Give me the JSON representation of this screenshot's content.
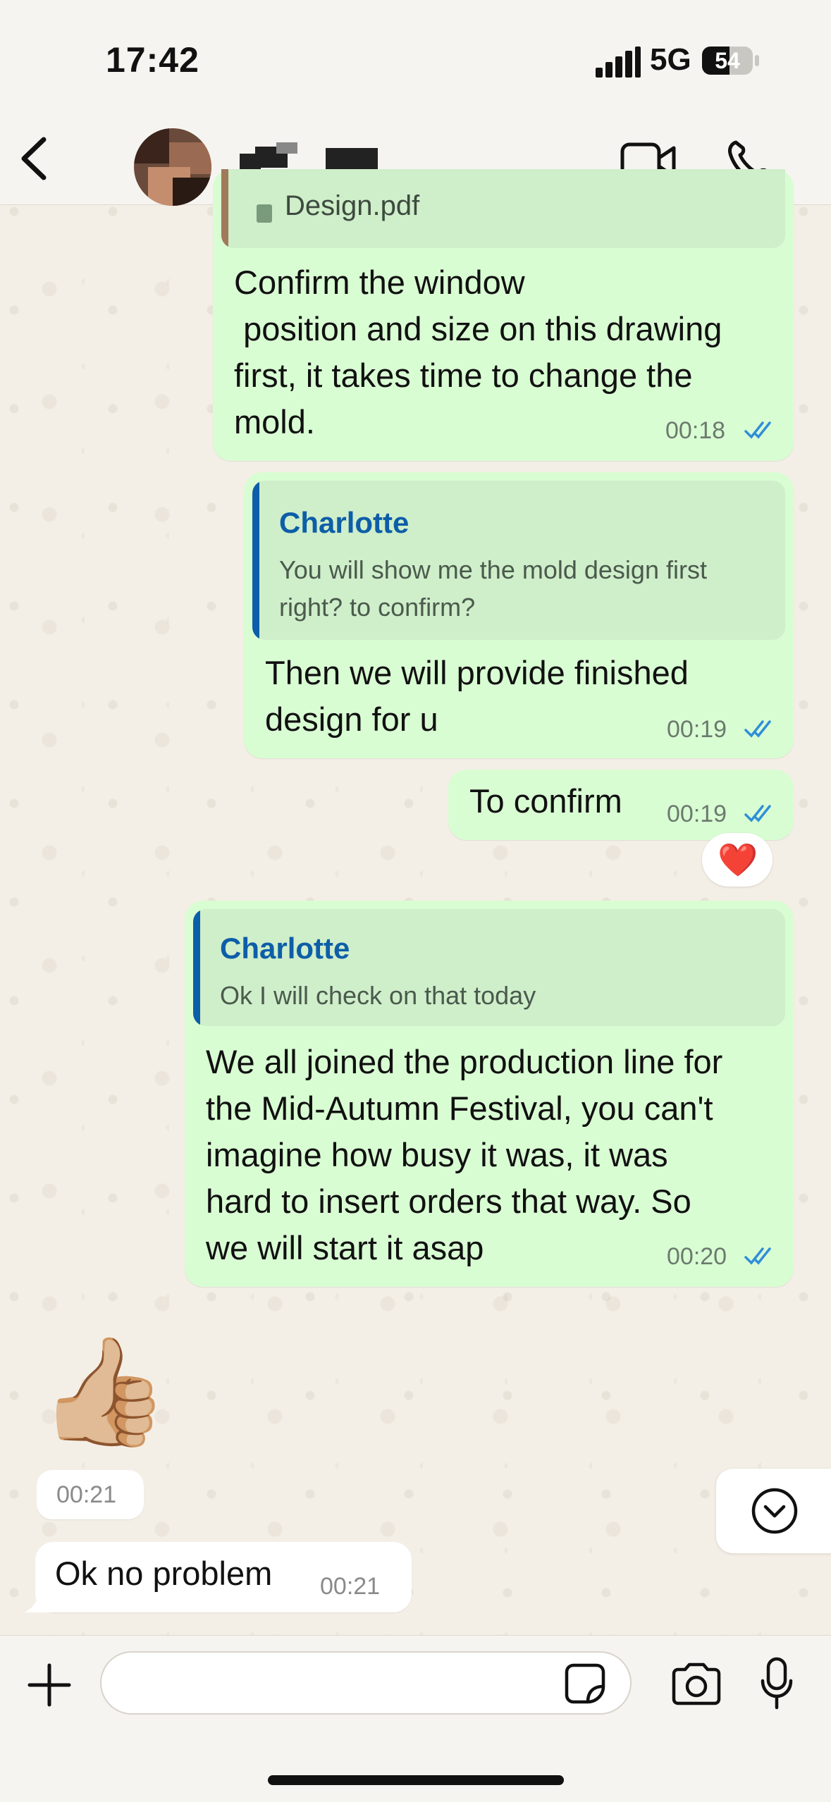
{
  "status": {
    "time": "17:42",
    "network": "5G",
    "battery": "54",
    "battery_level": 0.54
  },
  "header": {
    "contact_name": "",
    "icons": [
      "back-icon",
      "video-call-icon",
      "phone-icon"
    ]
  },
  "messages": [
    {
      "id": "m1",
      "direction": "out",
      "attachment": "Design.pdf",
      "text": "Confirm the window\n position and size on this drawing\nfirst, it takes time to change the\nmold.",
      "time": "00:18",
      "status": "read"
    },
    {
      "id": "m2",
      "direction": "out",
      "quote_author": "Charlotte",
      "quote_text": "You will show me the mold design first\nright? to confirm?",
      "text": "Then we will provide finished\ndesign for u",
      "time": "00:19",
      "status": "read"
    },
    {
      "id": "m3",
      "direction": "out",
      "text": "To confirm",
      "time": "00:19",
      "status": "read",
      "reaction": "❤️"
    },
    {
      "id": "m4",
      "direction": "out",
      "quote_author": "Charlotte",
      "quote_text": "Ok I will check on that today",
      "text": "We all joined the production line for\nthe Mid-Autumn Festival, you can't\nimagine how busy it was, it was\nhard to insert orders that way. So\nwe will start it asap",
      "time": "00:20",
      "status": "read"
    },
    {
      "id": "m5",
      "direction": "in",
      "sticker": "👍🏼",
      "time": "00:21"
    },
    {
      "id": "m6",
      "direction": "in",
      "text": "Ok no problem",
      "time": "00:21"
    }
  ],
  "input": {
    "placeholder": ""
  },
  "colors": {
    "outgoing_bubble": "#d9fdd3",
    "incoming_bubble": "#ffffff",
    "quote_accent": "#0d5ea8",
    "read_ticks": "#2f8fd8",
    "wallpaper": "#f4efe6"
  }
}
